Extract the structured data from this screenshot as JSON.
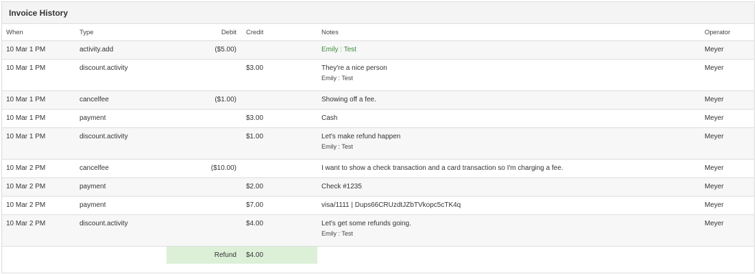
{
  "panel": {
    "title": "Invoice History"
  },
  "columns": {
    "when": "When",
    "type": "Type",
    "debit": "Debit",
    "credit": "Credit",
    "notes": "Notes",
    "operator": "Operator"
  },
  "rows": [
    {
      "when": "10 Mar 1 PM",
      "type": "activity.add",
      "debit": "($5.00)",
      "credit": "",
      "note": "Emily : Test",
      "note_sub": "",
      "operator": "Meyer"
    },
    {
      "when": "10 Mar 1 PM",
      "type": "discount.activity",
      "debit": "",
      "credit": "$3.00",
      "note": "They're a nice person",
      "note_sub": "Emily : Test",
      "operator": "Meyer"
    },
    {
      "when": "10 Mar 1 PM",
      "type": "cancelfee",
      "debit": "($1.00)",
      "credit": "",
      "note": "Showing off a fee.",
      "note_sub": "",
      "operator": "Meyer"
    },
    {
      "when": "10 Mar 1 PM",
      "type": "payment",
      "debit": "",
      "credit": "$3.00",
      "note": "Cash",
      "note_sub": "",
      "operator": "Meyer"
    },
    {
      "when": "10 Mar 1 PM",
      "type": "discount.activity",
      "debit": "",
      "credit": "$1.00",
      "note": "Let's make refund happen",
      "note_sub": "Emily : Test",
      "operator": "Meyer"
    },
    {
      "when": "10 Mar 2 PM",
      "type": "cancelfee",
      "debit": "($10.00)",
      "credit": "",
      "note": "I want to show a check transaction and a card transaction so I'm charging a fee.",
      "note_sub": "",
      "operator": "Meyer"
    },
    {
      "when": "10 Mar 2 PM",
      "type": "payment",
      "debit": "",
      "credit": "$2.00",
      "note": "Check #1235",
      "note_sub": "",
      "operator": "Meyer"
    },
    {
      "when": "10 Mar 2 PM",
      "type": "payment",
      "debit": "",
      "credit": "$7.00",
      "note": "visa/1111 | Dups66CRUzdtJZbTVkopc5cTK4q",
      "note_sub": "",
      "operator": "Meyer"
    },
    {
      "when": "10 Mar 2 PM",
      "type": "discount.activity",
      "debit": "",
      "credit": "$4.00",
      "note": "Let's get some refunds going.",
      "note_sub": "Emily : Test",
      "operator": "Meyer"
    }
  ],
  "refund": {
    "label": "Refund",
    "value": "$4.00"
  },
  "colors": {
    "header_bg": "#f4f4f4",
    "row_alt_bg": "#f7f7f7",
    "refund_bg": "#dcf0d8",
    "note_green": "#3c8a3c"
  }
}
